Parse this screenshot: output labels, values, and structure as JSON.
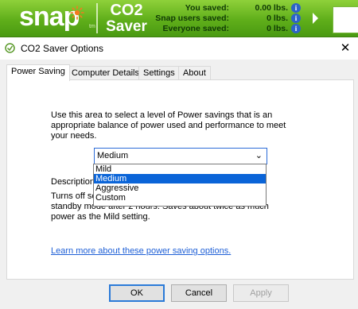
{
  "banner": {
    "logo": "snap",
    "tm": "tm",
    "co2": "CO2",
    "saver": "Saver",
    "stats": [
      {
        "label": "You saved:",
        "value": "0.00 lbs."
      },
      {
        "label": "Snap users saved:",
        "value": "0 lbs."
      },
      {
        "label": "Everyone saved:",
        "value": "0 lbs."
      }
    ],
    "info_icon": "i"
  },
  "window": {
    "title": "CO2 Saver Options",
    "close": "✕"
  },
  "tabs": [
    "Power Saving",
    "Computer Details",
    "Settings",
    "About"
  ],
  "power_saving": {
    "intro": "Use this area to select a level of Power savings that is an appropriate balance of power used and performance to meet your needs.",
    "selected": "Medium",
    "options": [
      "Mild",
      "Medium",
      "Aggressive",
      "Custom"
    ],
    "description_label": "Description:",
    "description": "Turns off screen after 15 minutes of inactivity. Enters standby mode after 2 hours. Saves about twice as much power as the Mild setting.",
    "link": "Learn more about these power saving options."
  },
  "buttons": {
    "ok": "OK",
    "cancel": "Cancel",
    "apply": "Apply"
  }
}
